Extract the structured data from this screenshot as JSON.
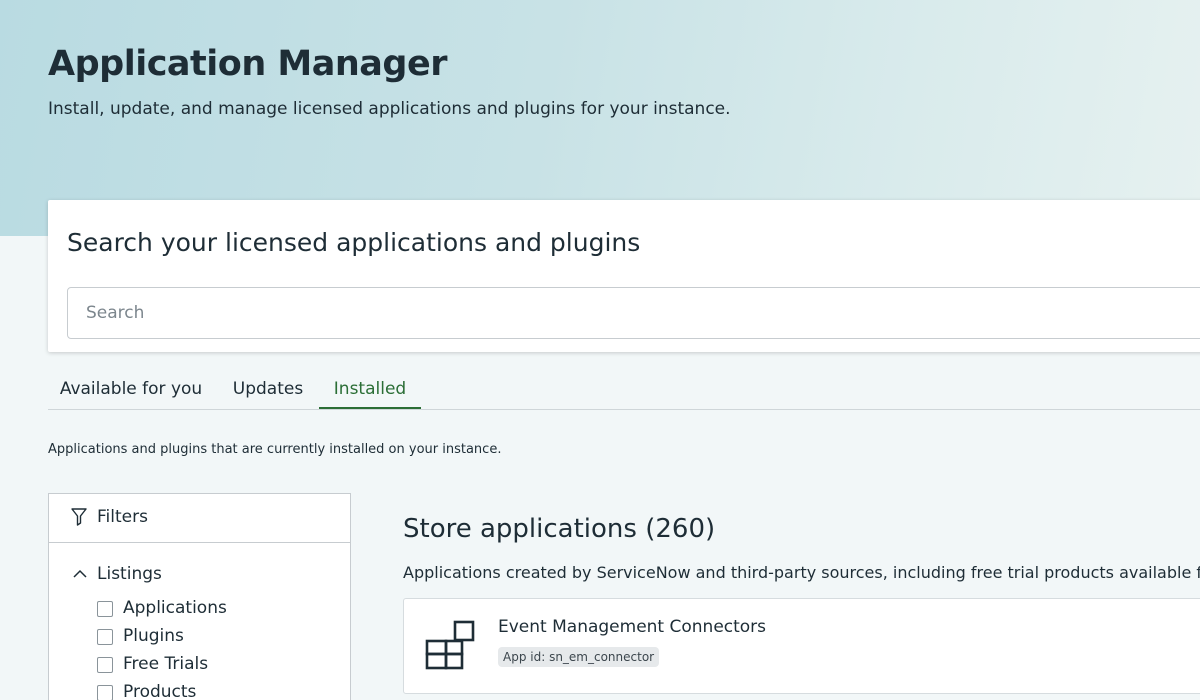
{
  "header": {
    "title": "Application Manager",
    "subtitle": "Install, update, and manage licensed applications and plugins for your instance."
  },
  "search": {
    "heading": "Search your licensed applications and plugins",
    "placeholder": "Search",
    "value": ""
  },
  "tabs": [
    {
      "label": "Available for you",
      "active": false
    },
    {
      "label": "Updates",
      "active": false
    },
    {
      "label": "Installed",
      "active": true
    }
  ],
  "tab_description": "Applications and plugins that are currently installed on your instance.",
  "filters": {
    "title": "Filters",
    "icon": "filter-icon",
    "sections": [
      {
        "label": "Listings",
        "expanded": true,
        "options": [
          {
            "label": "Applications",
            "checked": false
          },
          {
            "label": "Plugins",
            "checked": false
          },
          {
            "label": "Free Trials",
            "checked": false
          },
          {
            "label": "Products",
            "checked": false
          }
        ]
      }
    ]
  },
  "store": {
    "title": "Store applications (260)",
    "description": "Applications created by ServiceNow and third-party sources, including free trial products available for",
    "apps": [
      {
        "name": "Event Management Connectors",
        "app_id": "App id: sn_em_connector",
        "icon": "app-grid-icon"
      }
    ]
  },
  "colors": {
    "accent": "#2b6e36",
    "text": "#1e2d36",
    "hero_start": "#b9dbe2",
    "hero_end": "#e6f1f0"
  }
}
